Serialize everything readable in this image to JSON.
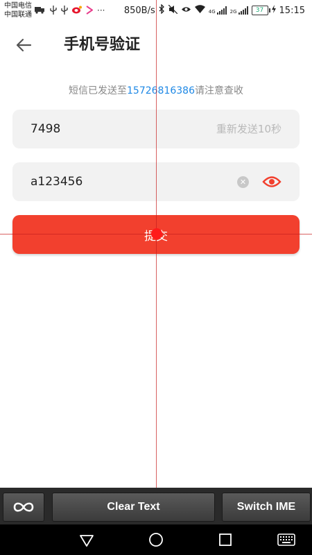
{
  "status_bar": {
    "carrier_1": "中国电信",
    "carrier_2": "中国联通",
    "more": "···",
    "speed": "850B/s",
    "network_tag_1": "4G",
    "network_tag_2": "2G",
    "battery": "37",
    "time": "15:15"
  },
  "header": {
    "title": "手机号验证"
  },
  "notice": {
    "prefix": "短信已发送至",
    "phone": "15726816386",
    "suffix": "请注意查收"
  },
  "code_field": {
    "value": "7498",
    "resend_label": "重新发送10秒"
  },
  "password_field": {
    "value": "a123456"
  },
  "submit_button": {
    "label": "提交"
  },
  "ime_bar": {
    "clear_label": "Clear Text",
    "switch_label": "Switch IME"
  },
  "colors": {
    "accent": "#f2402e",
    "link": "#1e88e5",
    "field_bg": "#f2f2f2"
  },
  "icons": [
    "back-arrow-icon",
    "clear-icon",
    "eye-icon",
    "infinity-icon",
    "nav-back-icon",
    "nav-home-icon",
    "nav-recents-icon",
    "keyboard-icon"
  ]
}
